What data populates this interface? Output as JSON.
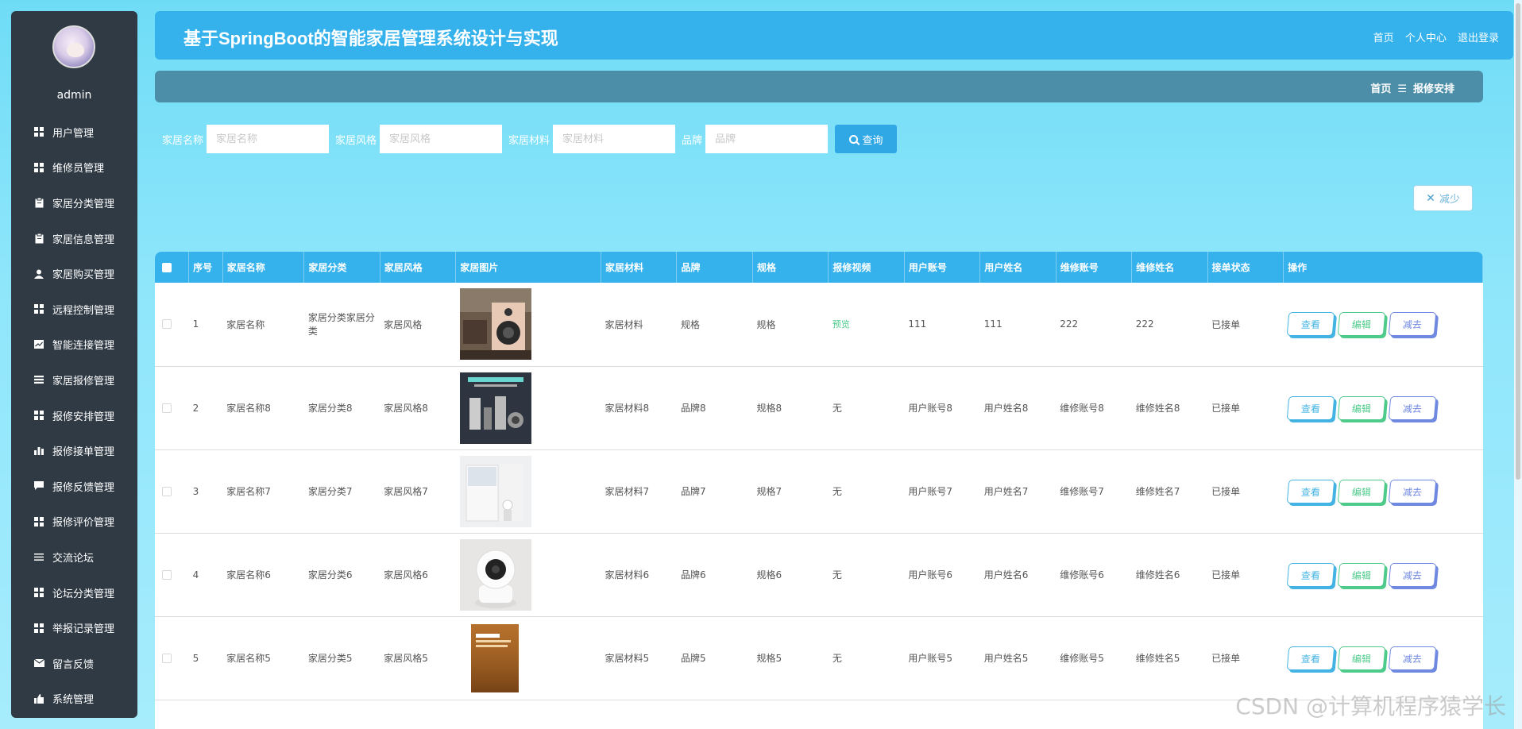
{
  "sidebar": {
    "username": "admin",
    "items": [
      {
        "label": "用户管理",
        "icon": "grid-icon"
      },
      {
        "label": "维修员管理",
        "icon": "grid-icon"
      },
      {
        "label": "家居分类管理",
        "icon": "clipboard-icon"
      },
      {
        "label": "家居信息管理",
        "icon": "clipboard-icon"
      },
      {
        "label": "家居购买管理",
        "icon": "user-icon"
      },
      {
        "label": "远程控制管理",
        "icon": "grid-icon"
      },
      {
        "label": "智能连接管理",
        "icon": "chart-line-icon"
      },
      {
        "label": "家居报修管理",
        "icon": "list-icon"
      },
      {
        "label": "报修安排管理",
        "icon": "grid-icon"
      },
      {
        "label": "报修接单管理",
        "icon": "bar-chart-icon"
      },
      {
        "label": "报修反馈管理",
        "icon": "chat-icon"
      },
      {
        "label": "报修评价管理",
        "icon": "grid-icon"
      },
      {
        "label": "交流论坛",
        "icon": "lines-icon"
      },
      {
        "label": "论坛分类管理",
        "icon": "grid-icon"
      },
      {
        "label": "举报记录管理",
        "icon": "grid-icon"
      },
      {
        "label": "留言反馈",
        "icon": "message-icon"
      },
      {
        "label": "系统管理",
        "icon": "thumb-up-icon"
      }
    ]
  },
  "header": {
    "title": "基于SpringBoot的智能家居管理系统设计与实现",
    "links": {
      "home": "首页",
      "profile": "个人中心",
      "logout": "退出登录"
    }
  },
  "breadcrumb": {
    "home": "首页",
    "separator": "☰",
    "current": "报修安排"
  },
  "search": {
    "fields": [
      {
        "label": "家居名称",
        "placeholder": "家居名称"
      },
      {
        "label": "家居风格",
        "placeholder": "家居风格"
      },
      {
        "label": "家居材料",
        "placeholder": "家居材料"
      },
      {
        "label": "品牌",
        "placeholder": "品牌"
      }
    ],
    "button": "查询"
  },
  "reduce_button": "减少",
  "table": {
    "columns": [
      "序号",
      "家居名称",
      "家居分类",
      "家居风格",
      "家居图片",
      "家居材料",
      "品牌",
      "规格",
      "报修视频",
      "用户账号",
      "用户姓名",
      "维修账号",
      "维修姓名",
      "接单状态",
      "操作"
    ],
    "actions": {
      "view": "查看",
      "edit": "编辑",
      "delete": "减去"
    },
    "rows": [
      {
        "no": "1",
        "name": "家居名称",
        "category": "家居分类家居分类",
        "style": "家居风格",
        "image": "speaker-photo",
        "material": "家居材料",
        "brand": "规格",
        "spec": "规格",
        "video": "预览",
        "user_account": "111",
        "user_name": "111",
        "repair_account": "222",
        "repair_name": "222",
        "status": "已接单"
      },
      {
        "no": "2",
        "name": "家居名称8",
        "category": "家居分类8",
        "style": "家居风格8",
        "image": "smart-home-poster",
        "material": "家居材料8",
        "brand": "品牌8",
        "spec": "规格8",
        "video": "无",
        "user_account": "用户账号8",
        "user_name": "用户姓名8",
        "repair_account": "维修账号8",
        "repair_name": "维修姓名8",
        "status": "已接单"
      },
      {
        "no": "3",
        "name": "家居名称7",
        "category": "家居分类7",
        "style": "家居风格7",
        "image": "fridge-photo",
        "material": "家居材料7",
        "brand": "品牌7",
        "spec": "规格7",
        "video": "无",
        "user_account": "用户账号7",
        "user_name": "用户姓名7",
        "repair_account": "维修账号7",
        "repair_name": "维修姓名7",
        "status": "已接单"
      },
      {
        "no": "4",
        "name": "家居名称6",
        "category": "家居分类6",
        "style": "家居风格6",
        "image": "camera-photo",
        "material": "家居材料6",
        "brand": "品牌6",
        "spec": "规格6",
        "video": "无",
        "user_account": "用户账号6",
        "user_name": "用户姓名6",
        "repair_account": "维修账号6",
        "repair_name": "维修姓名6",
        "status": "已接单"
      },
      {
        "no": "5",
        "name": "家居名称5",
        "category": "家居分类5",
        "style": "家居风格5",
        "image": "book-photo",
        "material": "家居材料5",
        "brand": "品牌5",
        "spec": "规格5",
        "video": "无",
        "user_account": "用户账号5",
        "user_name": "用户姓名5",
        "repair_account": "维修账号5",
        "repair_name": "维修姓名5",
        "status": "已接单"
      }
    ]
  },
  "watermark": "CSDN @计算机程序猿学长",
  "colors": {
    "header": "#35b2ec",
    "sidebar": "#2f3a44",
    "crumb": "#4c8ea8",
    "view": "#43b3e3",
    "edit": "#4ecb8b",
    "delete": "#6f88e0"
  }
}
